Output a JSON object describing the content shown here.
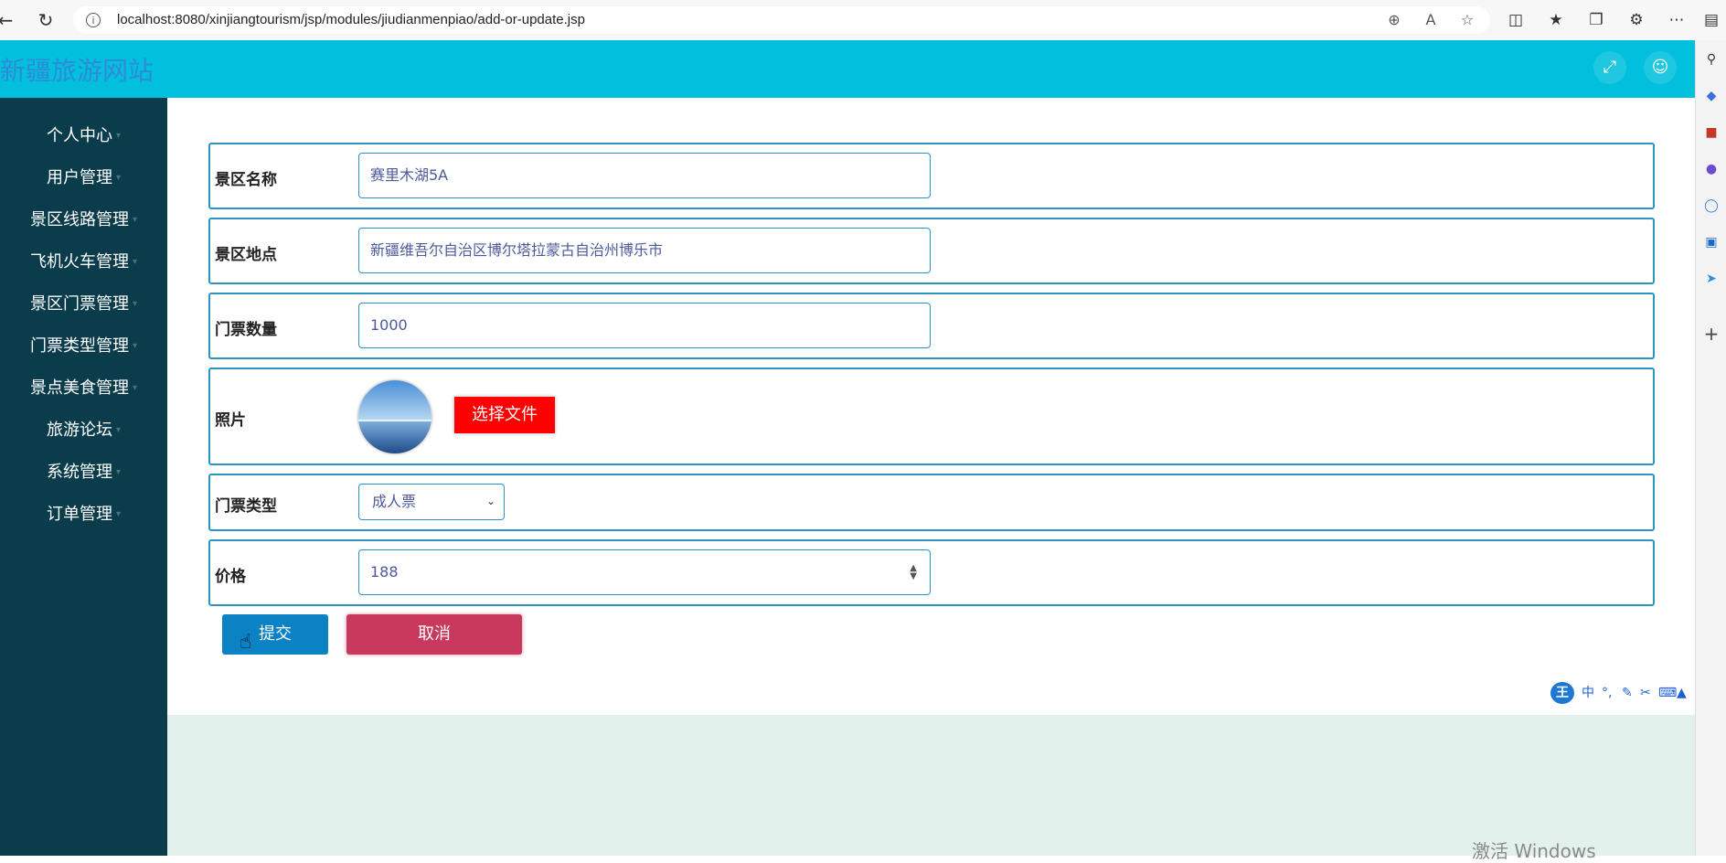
{
  "browser": {
    "url": "localhost:8080/xinjiangtourism/jsp/modules/jiudianmenpiao/add-or-update.jsp"
  },
  "header": {
    "site_title": "新疆旅游网站"
  },
  "sidebar": {
    "items": [
      {
        "label": "个人中心"
      },
      {
        "label": "用户管理"
      },
      {
        "label": "景区线路管理"
      },
      {
        "label": "飞机火车管理"
      },
      {
        "label": "景区门票管理"
      },
      {
        "label": "门票类型管理"
      },
      {
        "label": "景点美食管理"
      },
      {
        "label": "旅游论坛"
      },
      {
        "label": "系统管理"
      },
      {
        "label": "订单管理"
      }
    ]
  },
  "form": {
    "name_label": "景区名称",
    "name_value": "赛里木湖5A",
    "location_label": "景区地点",
    "location_value": "新疆维吾尔自治区博尔塔拉蒙古自治州博乐市",
    "quantity_label": "门票数量",
    "quantity_value": "1000",
    "photo_label": "照片",
    "choose_file_label": "选择文件",
    "type_label": "门票类型",
    "type_selected": "成人票",
    "price_label": "价格",
    "price_value": "188",
    "submit_label": "提交",
    "cancel_label": "取消"
  },
  "ime": {
    "logo": "王",
    "mode": "中"
  },
  "watermark": "激活 Windows",
  "colors": {
    "header_bg": "#00c0dd",
    "sidebar_bg": "#0b3c4c",
    "submit_bg": "#0a82c3",
    "cancel_bg": "#c9385d",
    "file_button_bg": "#ff0000"
  }
}
